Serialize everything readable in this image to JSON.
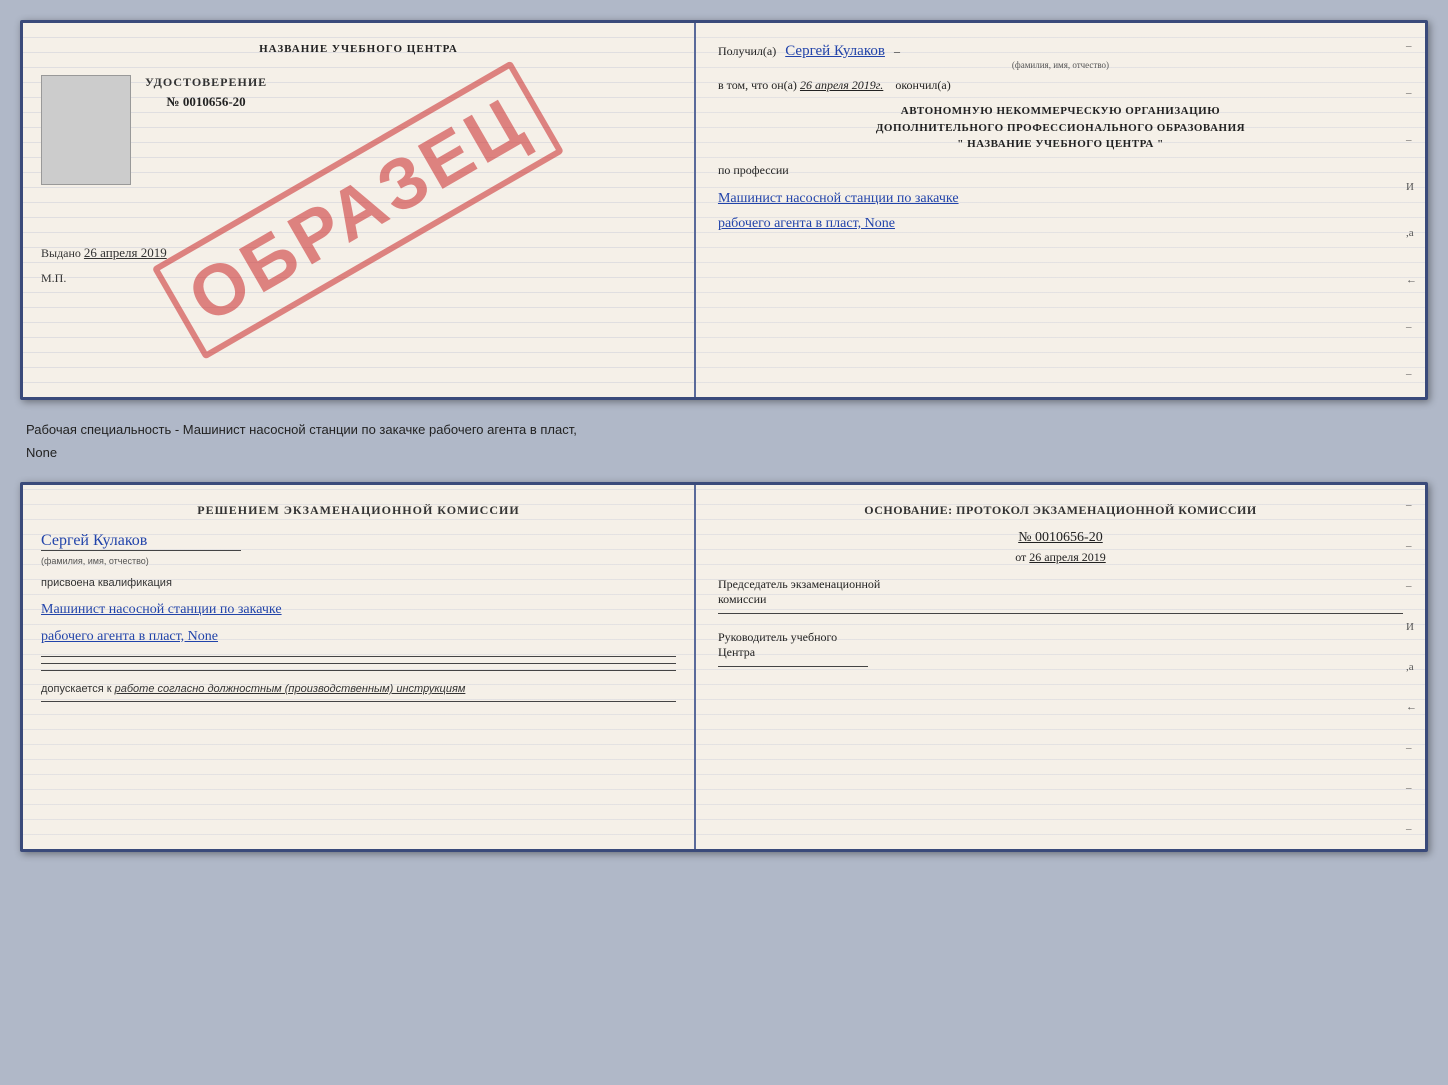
{
  "top_document": {
    "left": {
      "center_title": "НАЗВАНИЕ УЧЕБНОГО ЦЕНТРА",
      "photo_alt": "фото",
      "udostoverenie_label": "УДОСТОВЕРЕНИЕ",
      "cert_number": "№ 0010656-20",
      "stamp_text": "ОБРАЗЕЦ",
      "vydano_label": "Выдано",
      "vydano_date": "26 апреля 2019",
      "mp_label": "М.П."
    },
    "right": {
      "poluchil_label": "Получил(а)",
      "recipient_name": "Сергей Кулаков",
      "fio_sublabel": "(фамилия, имя, отчество)",
      "vtom_label": "в том, что он(а)",
      "completed_date": "26 апреля 2019г.",
      "okonchil_label": "окончил(а)",
      "org_line1": "АВТОНОМНУЮ НЕКОММЕРЧЕСКУЮ ОРГАНИЗАЦИЮ",
      "org_line2": "ДОПОЛНИТЕЛЬНОГО ПРОФЕССИОНАЛЬНОГО ОБРАЗОВАНИЯ",
      "org_line3": "\"  НАЗВАНИЕ УЧЕБНОГО ЦЕНТРА  \"",
      "po_professii_label": "по профессии",
      "profession_line1": "Машинист насосной станции по закачке",
      "profession_line2": "рабочего агента в пласт, None",
      "dashes": [
        "-",
        "-",
        "-",
        "И",
        ",а",
        "←",
        "-",
        "-",
        "-"
      ]
    }
  },
  "subtitle": "Рабочая специальность - Машинист насосной станции по закачке рабочего агента в пласт,",
  "subtitle2": "None",
  "bottom_document": {
    "left": {
      "komissia_title": "Решением экзаменационной комиссии",
      "name": "Сергей Кулаков",
      "fio_sublabel": "(фамилия, имя, отчество)",
      "prisvoena_label": "присвоена квалификация",
      "qualification_line1": "Машинист насосной станции по закачке",
      "qualification_line2": "рабочего агента в пласт, None",
      "dopuskaetsya_label": "допускается к",
      "dopuskaetsya_text": "работе согласно должностным (производственным) инструкциям"
    },
    "right": {
      "osnov_title": "Основание: протокол экзаменационной комиссии",
      "protocol_number": "№ 0010656-20",
      "ot_label": "от",
      "protocol_date": "26 апреля 2019",
      "predsedatel_line1": "Председатель экзаменационной",
      "predsedatel_line2": "комиссии",
      "rukov_line1": "Руководитель учебного",
      "rukov_line2": "Центра",
      "dashes": [
        "-",
        "-",
        "-",
        "И",
        ",а",
        "←",
        "-",
        "-",
        "-",
        "-"
      ]
    }
  }
}
